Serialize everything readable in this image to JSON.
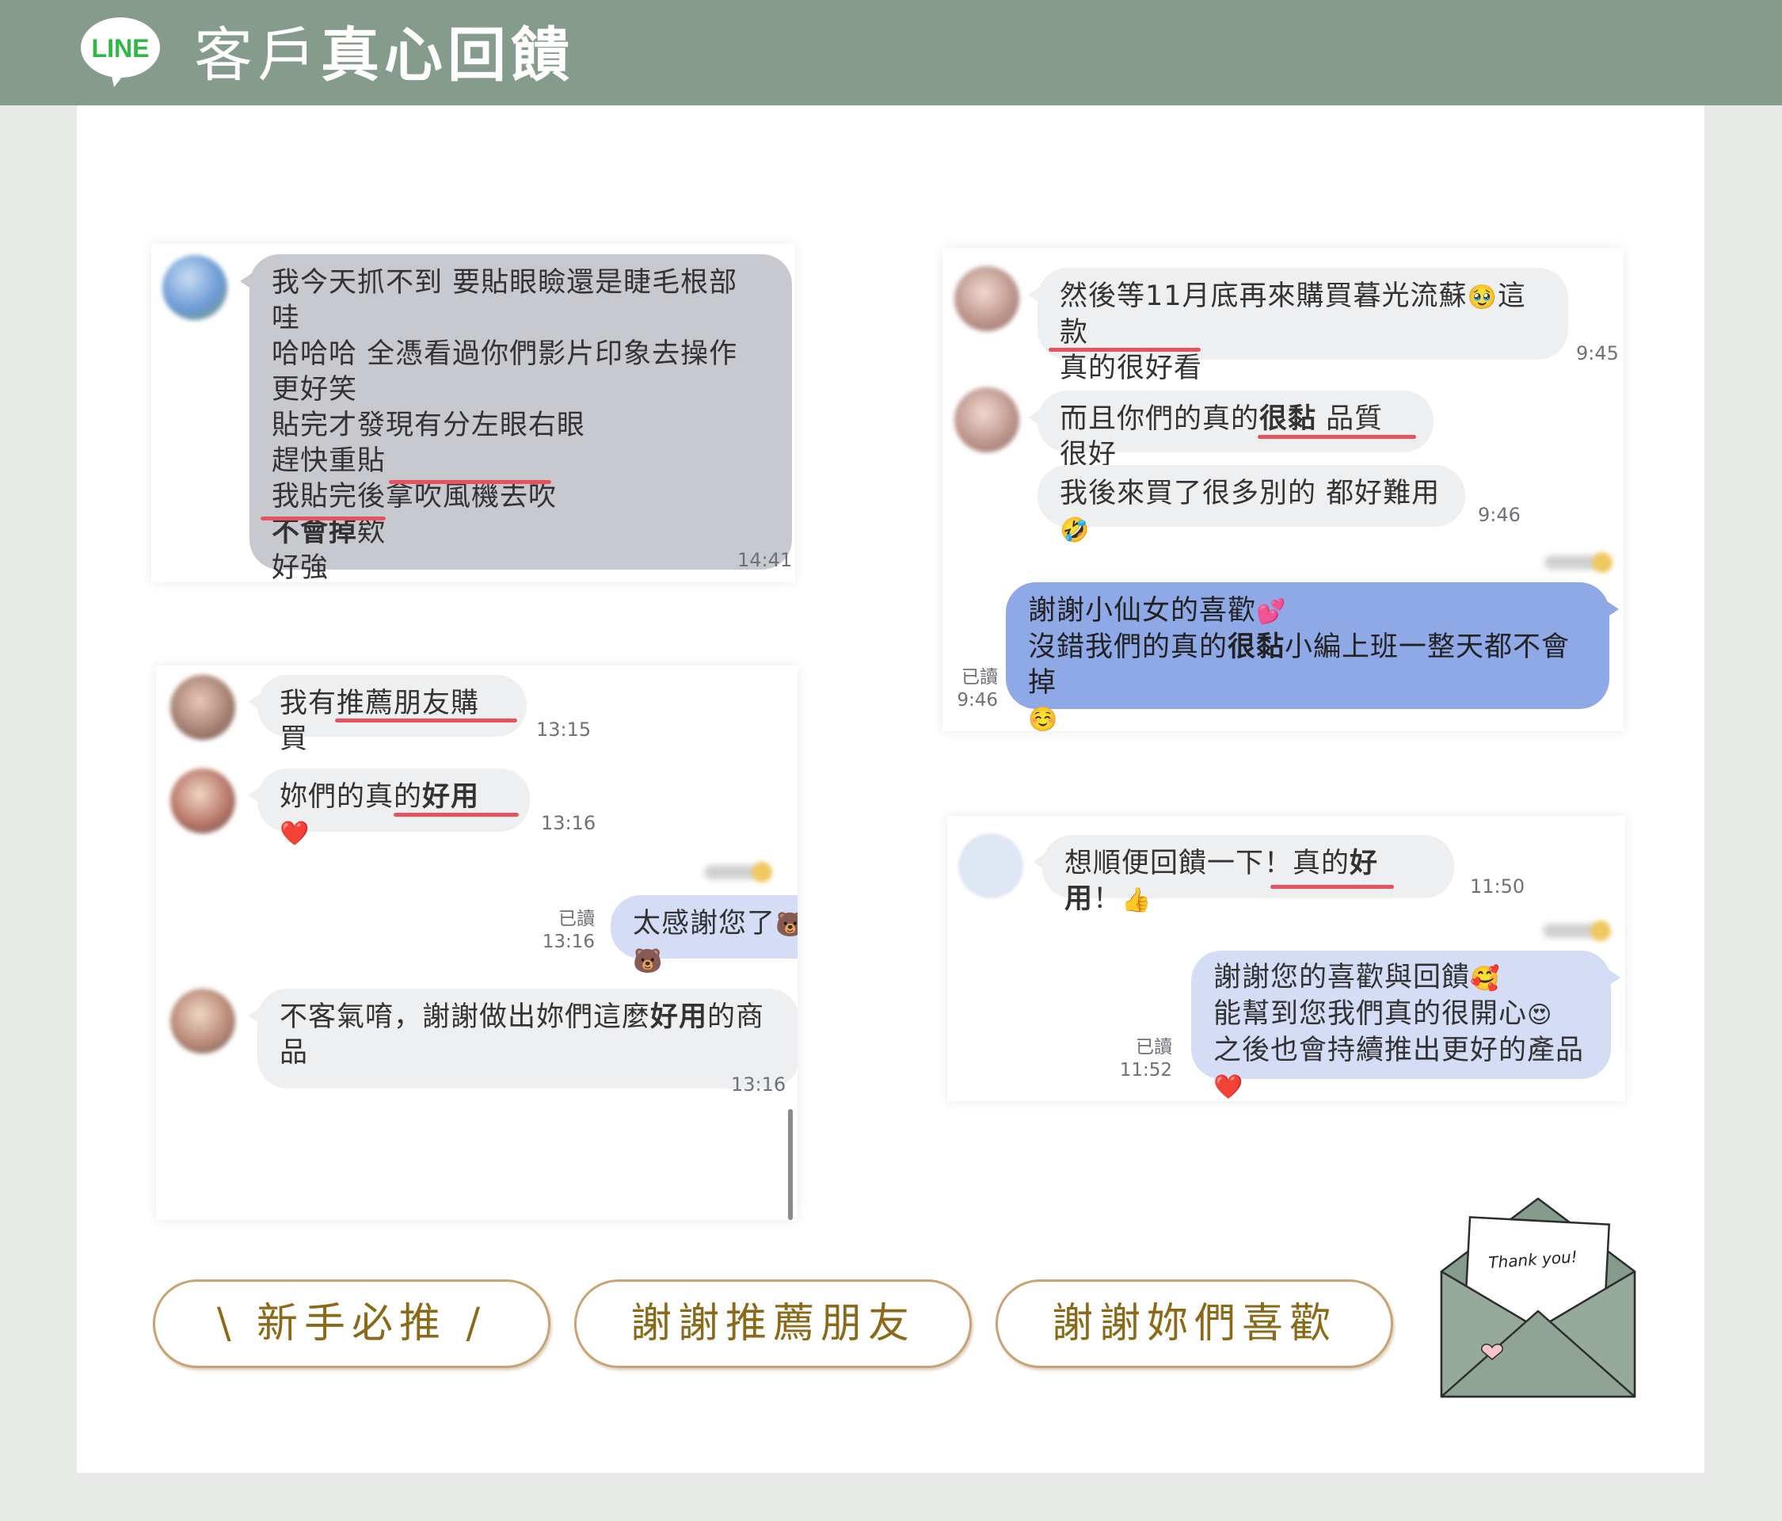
{
  "header": {
    "logo_text": "LINE",
    "title_light": "客戶",
    "title_bold": "真心回饋"
  },
  "colors": {
    "header_bg": "#859b8b",
    "panel_bg": "#ffffff",
    "bubble_theirs": "#c7c9ce",
    "bubble_mine": "#d4dcf6",
    "bubble_mine_strong": "#8fa8e6",
    "underline": "#e8525f",
    "button_border": "#c9a373",
    "button_text": "#8a6a18"
  },
  "card1": {
    "line1": "我今天抓不到 要貼眼瞼還是睫毛根部 哇",
    "line2": "哈哈哈 全憑看過你們影片印象去操作",
    "line3": "更好笑",
    "line4": "貼完才發現有分左眼右眼",
    "line5": "趕快重貼",
    "line6a": "我貼完後",
    "line6b": "拿吹風機去吹",
    "line7a": "不會掉",
    "line7b": "欸",
    "line8": "好強",
    "time": "14:41"
  },
  "card2": {
    "msg1a": "然後等11月底再來購買暮光流蘇",
    "msg1b": "這款",
    "msg1c": "真的很好看",
    "time1": "9:45",
    "msg2a": "而且你們的",
    "msg2b": "真的",
    "msg2c": "很黏",
    "msg2d": " 品質很好",
    "msg3": "我後來買了很多別的 都好難用",
    "time2": "9:46",
    "reply1": "謝謝小仙女的喜歡",
    "reply2a": "沒錯我們的真的",
    "reply2b": "很黏",
    "reply2c": "小編上班一整天都不會掉",
    "read_label": "已讀",
    "read_time": "9:46"
  },
  "card3": {
    "msg1a": "我有",
    "msg1b": "推薦朋友購買",
    "time1": "13:15",
    "msg2a": "妳們的真的",
    "msg2b": "好用",
    "time2": "13:16",
    "reply": "太感謝您了",
    "read_label": "已讀",
    "read_time": "13:16",
    "msg3a": "不客氣唷，謝謝做出妳們這麼",
    "msg3b": "好用",
    "msg3c": "的商",
    "msg3d": "品",
    "time3": "13:16"
  },
  "card4": {
    "msg1a": "想順便回饋一下！",
    "msg1b": "真的",
    "msg1c": "好用",
    "msg1d": "！",
    "time1": "11:50",
    "reply1": "謝謝您的喜歡與回饋",
    "reply2": "能幫到您我們真的很開心",
    "reply3": "之後也會持續推出更好的產品",
    "read_label": "已讀",
    "read_time": "11:52"
  },
  "buttons": {
    "b1": "\\ 新手必推 /",
    "b2": "謝謝推薦朋友",
    "b3": "謝謝妳們喜歡"
  },
  "envelope": {
    "note": "Thank you!"
  }
}
